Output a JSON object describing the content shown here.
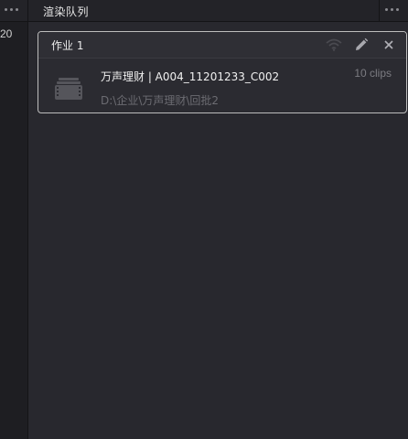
{
  "left_panel": {
    "value": "20"
  },
  "render_queue": {
    "title": "渲染队列"
  },
  "job": {
    "title": "作业 1",
    "clip": {
      "name": "万声理财 | A004_11201233_C002",
      "count": "10 clips",
      "path": "D:\\企业\\万声理财\\回批2"
    },
    "icons": [
      "remote-render-icon",
      "edit-icon",
      "close-icon"
    ]
  },
  "colors": {
    "background": "#28282e",
    "card_border": "#bdbdbd",
    "text_primary": "#f0f0f0",
    "text_muted": "#6c6c72"
  }
}
